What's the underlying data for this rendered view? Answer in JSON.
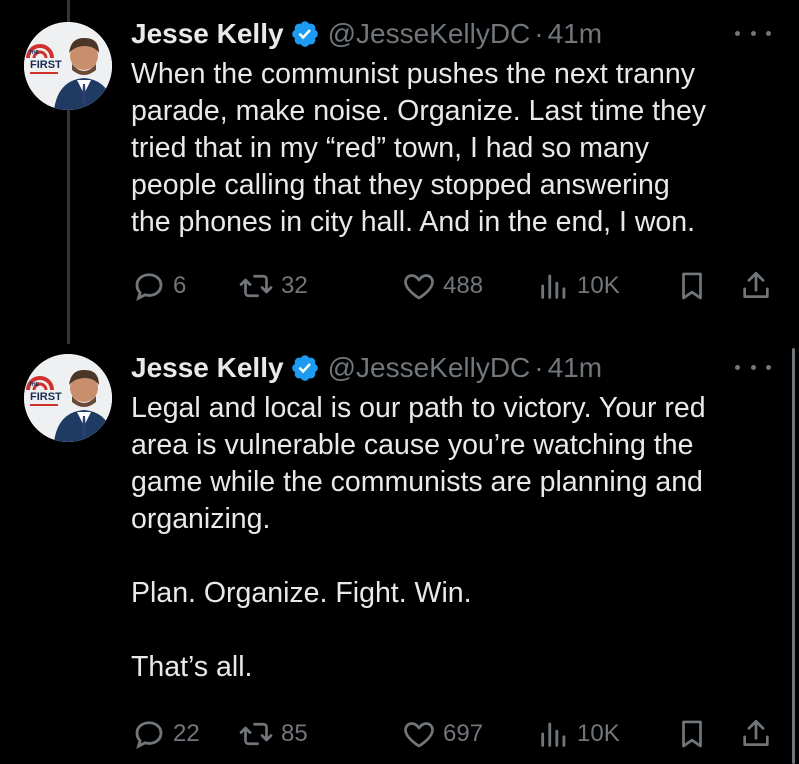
{
  "colors": {
    "background": "#000000",
    "text_primary": "#e7e9ea",
    "text_secondary": "#71767b",
    "verified_badge": "#1d9bf0"
  },
  "tweets": [
    {
      "author": {
        "name": "Jesse Kelly",
        "handle": "@JesseKellyDC",
        "verified": true,
        "avatar_logo": "FIRST"
      },
      "separator": "·",
      "time": "41m",
      "text": "When the communist pushes the next tranny\nparade, make noise. Organize. Last time they\ntried that in my “red” town, I had so many\npeople calling that they stopped answering\nthe phones in city hall. And in the end, I won.",
      "stats": {
        "replies": "6",
        "reposts": "32",
        "likes": "488",
        "views": "10K"
      },
      "icons": [
        "reply-icon",
        "repost-icon",
        "like-icon",
        "views-icon",
        "bookmark-icon",
        "share-icon",
        "more-icon",
        "verified-icon"
      ]
    },
    {
      "author": {
        "name": "Jesse Kelly",
        "handle": "@JesseKellyDC",
        "verified": true,
        "avatar_logo": "FIRST"
      },
      "separator": "·",
      "time": "41m",
      "text": "Legal and local is our path to victory. Your red\narea is vulnerable cause you’re watching the\ngame while the communists are planning and\norganizing.\n\nPlan. Organize. Fight. Win.\n\nThat’s all.",
      "stats": {
        "replies": "22",
        "reposts": "85",
        "likes": "697",
        "views": "10K"
      },
      "icons": [
        "reply-icon",
        "repost-icon",
        "like-icon",
        "views-icon",
        "bookmark-icon",
        "share-icon",
        "more-icon",
        "verified-icon"
      ]
    }
  ]
}
